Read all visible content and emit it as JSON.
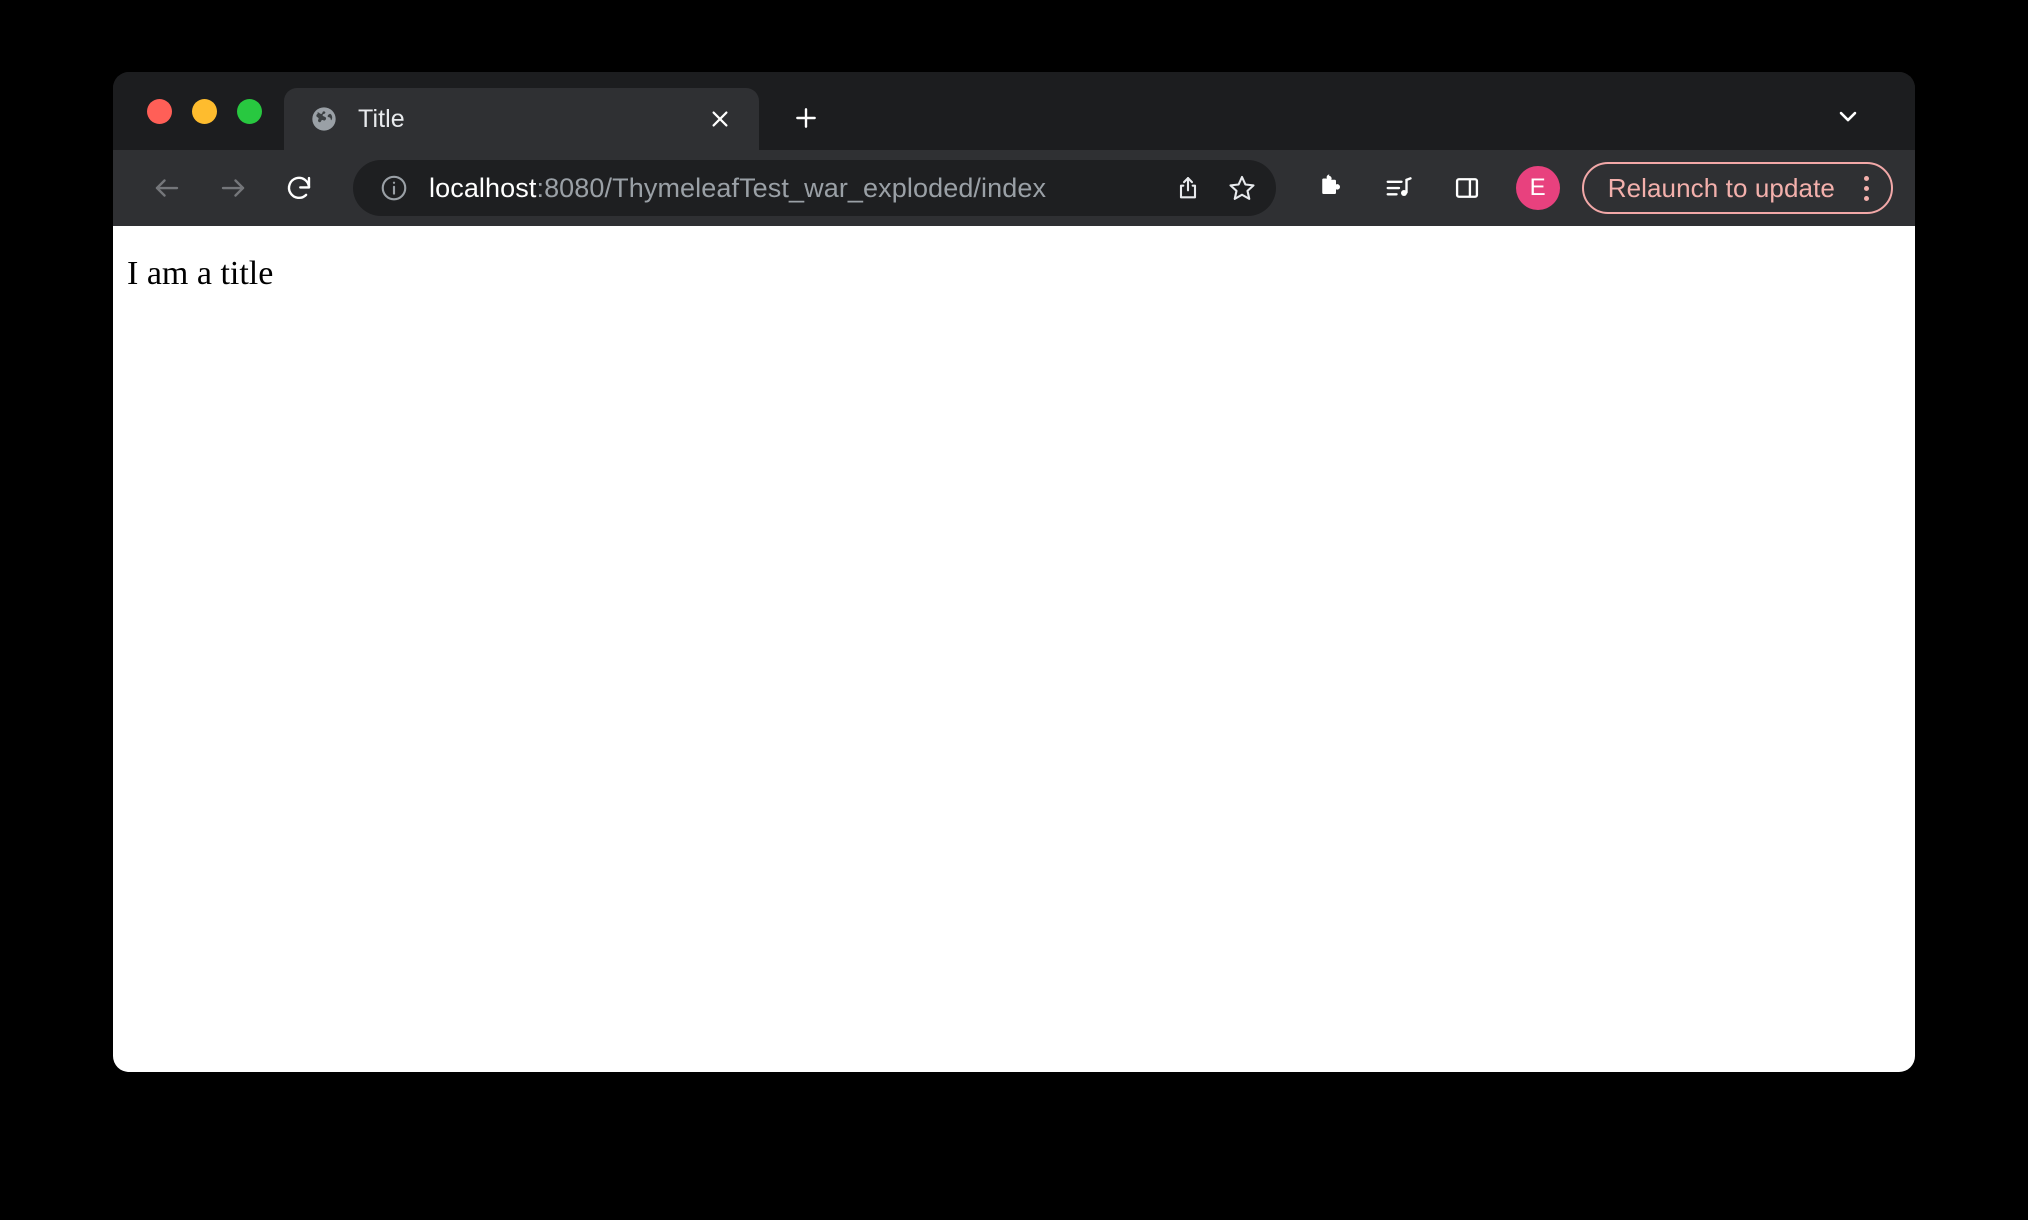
{
  "window": {
    "traffic_lights": [
      {
        "name": "close",
        "color": "#ff5f57"
      },
      {
        "name": "minimize",
        "color": "#febc2e"
      },
      {
        "name": "maximize",
        "color": "#28c840"
      }
    ]
  },
  "tab_strip": {
    "tabs": [
      {
        "title": "Title",
        "favicon": "globe-icon",
        "active": true
      }
    ],
    "new_tab_label": "+",
    "tab_search_icon": "chevron-down-icon"
  },
  "toolbar": {
    "back_icon": "arrow-left-icon",
    "forward_icon": "arrow-right-icon",
    "reload_icon": "reload-icon",
    "site_info_icon": "info-circle-icon",
    "url": {
      "host": "localhost",
      "rest": ":8080/ThymeleafTest_war_exploded/index",
      "full": "localhost:8080/ThymeleafTest_war_exploded/index"
    },
    "share_icon": "share-icon",
    "bookmark_icon": "star-icon",
    "extensions_icon": "puzzle-piece-icon",
    "media_icon": "media-music-icon",
    "side_panel_icon": "side-panel-icon",
    "avatar_initial": "E",
    "avatar_color": "#e8417e",
    "update_button": {
      "label": "Relaunch to update",
      "accent_color": "#f3b0ac",
      "menu_icon": "kebab-menu-icon"
    }
  },
  "page": {
    "heading": "I am a title"
  }
}
